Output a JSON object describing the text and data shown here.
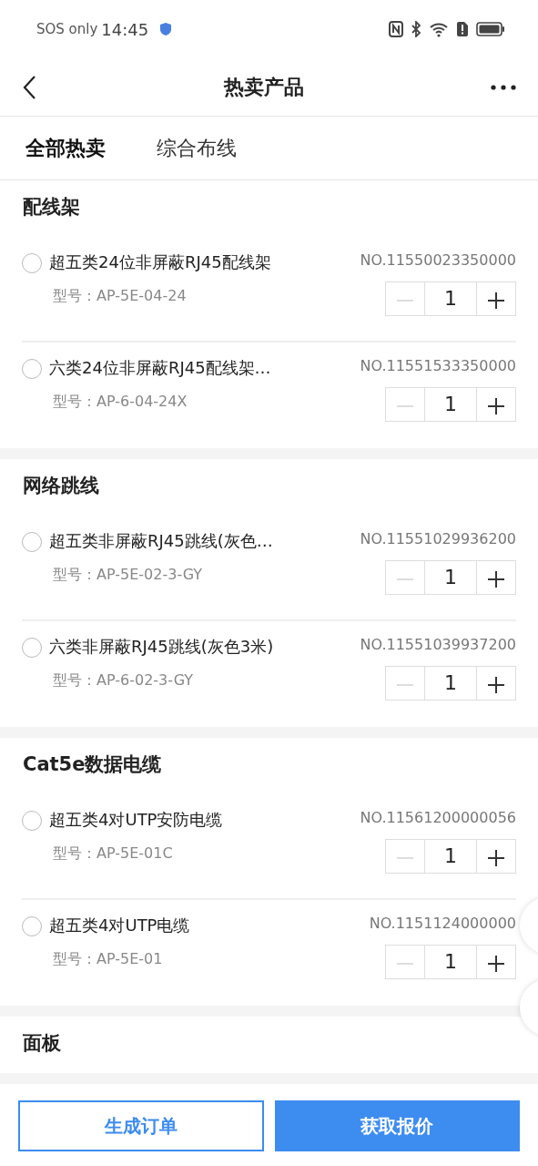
{
  "status_bar": {
    "carrier": "SOS only",
    "time": "14:45"
  },
  "header": {
    "title": "热卖产品"
  },
  "tabs": [
    {
      "label": "全部热卖",
      "selected": true
    },
    {
      "label": "综合布线",
      "selected": false
    }
  ],
  "sections": [
    {
      "title": "配线架",
      "items": [
        {
          "name": "超五类24位非屏蔽RJ45配线架",
          "number": "NO.11550023350000",
          "model": "型号：AP-5E-04-24",
          "quantity": "1",
          "selected": false,
          "decrement_disabled": true
        },
        {
          "name": "六类24位非屏蔽RJ45配线架…",
          "number": "NO.11551533350000",
          "model": "型号：AP-6-04-24X",
          "quantity": "1",
          "selected": false,
          "decrement_disabled": true
        }
      ]
    },
    {
      "title": "网络跳线",
      "items": [
        {
          "name": "超五类非屏蔽RJ45跳线(灰色…",
          "number": "NO.11551029936200",
          "model": "型号：AP-5E-02-3-GY",
          "quantity": "1",
          "selected": false,
          "decrement_disabled": true
        },
        {
          "name": "六类非屏蔽RJ45跳线(灰色3米)",
          "number": "NO.11551039937200",
          "model": "型号：AP-6-02-3-GY",
          "quantity": "1",
          "selected": false,
          "decrement_disabled": true
        }
      ]
    },
    {
      "title": "Cat5e数据电缆",
      "items": [
        {
          "name": "超五类4对UTP安防电缆",
          "number": "NO.11561200000056",
          "model": "型号：AP-5E-01C",
          "quantity": "1",
          "selected": false,
          "decrement_disabled": true
        },
        {
          "name": "超五类4对UTP电缆",
          "number": "NO.1151124000000",
          "model": "型号：AP-5E-01",
          "quantity": "1",
          "selected": false,
          "decrement_disabled": true
        }
      ]
    },
    {
      "title": "面板"
    }
  ],
  "footer": {
    "buttons": [
      {
        "label": "生成订单",
        "kind": "outline"
      },
      {
        "label": "获取报价",
        "kind": "primary"
      }
    ]
  }
}
